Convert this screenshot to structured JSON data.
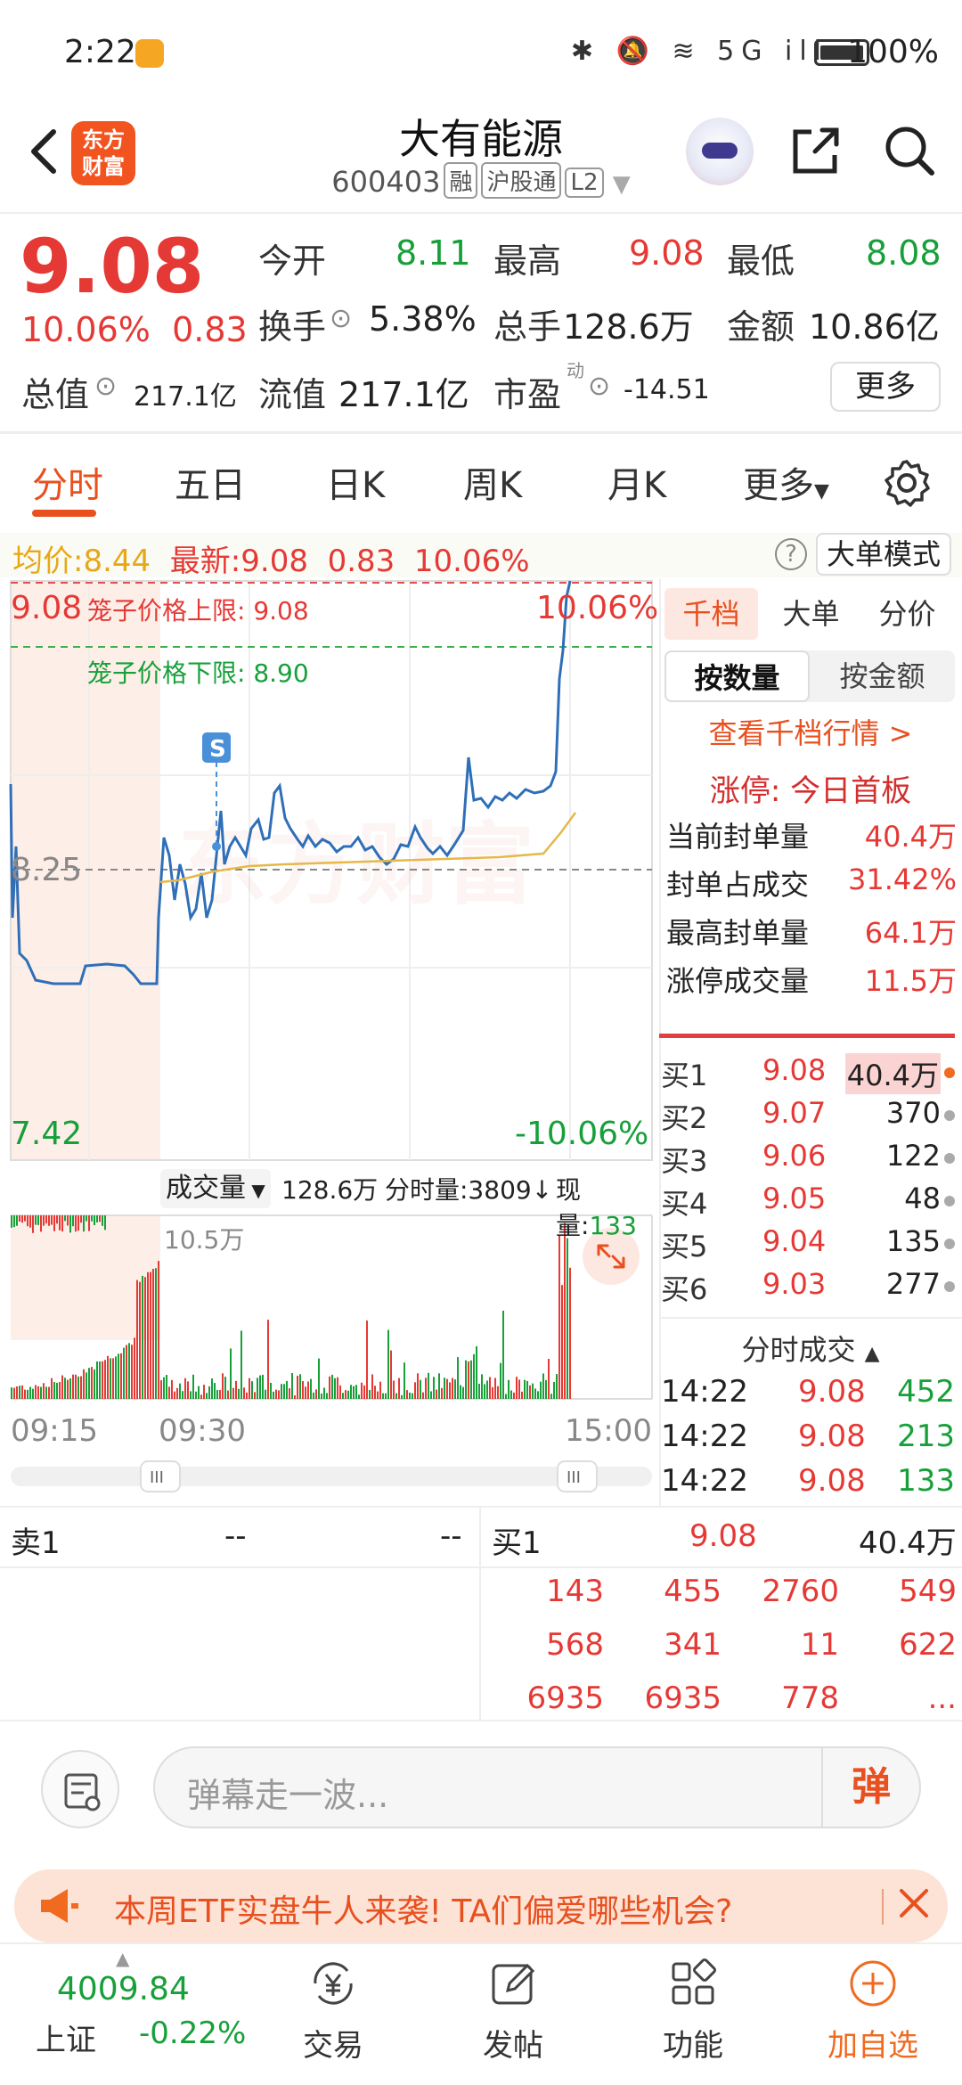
{
  "status_bar": {
    "time": "2:22",
    "battery": "100%",
    "icons": "✱ 🔕 ≋ 5G ill"
  },
  "header": {
    "logo_line1": "东方",
    "logo_line2": "财富",
    "stock_name": "大有能源",
    "stock_code": "600403",
    "tags": [
      "融",
      "沪股通",
      "L2"
    ]
  },
  "quote": {
    "price": "9.08",
    "change_pct": "10.06%",
    "change_abs": "0.83",
    "open_label": "今开",
    "open": "8.11",
    "high_label": "最高",
    "high": "9.08",
    "low_label": "最低",
    "low": "8.08",
    "turnover_label": "换手",
    "turnover": "5.38%",
    "volume_label": "总手",
    "volume": "128.6万",
    "amount_label": "金额",
    "amount": "10.86亿",
    "mktcap_label": "总值",
    "mktcap": "217.1亿",
    "float_label": "流值",
    "float": "217.1亿",
    "pe_label": "市盈",
    "pe_sup": "动",
    "pe": "-14.51",
    "more": "更多"
  },
  "tabs": [
    "分时",
    "五日",
    "日K",
    "周K",
    "月K",
    "更多"
  ],
  "avg_bar": {
    "avg_label": "均价:",
    "avg": "8.44",
    "latest_label": "最新:",
    "latest": "9.08",
    "chg": "0.83",
    "pct": "10.06%",
    "help": "?",
    "big_order": "大单模式"
  },
  "chart": {
    "top_price": "9.08",
    "upper_limit": "笼子价格上限: 9.08",
    "lower_limit": "笼子价格下限: 8.90",
    "top_pct": "10.06%",
    "mid_price": "8.25",
    "bottom_price": "7.42",
    "bottom_pct": "-10.06%",
    "marker": "S",
    "watermark": "东方财富",
    "vol_selector": "成交量",
    "vol_total": "128.6万",
    "vol_minute": "分时量:3809↓",
    "vol_now_label": "现量:",
    "vol_now": "133",
    "vol_max": "10.5万",
    "time_start": "09:15",
    "time_open": "09:30",
    "time_end": "15:00"
  },
  "chart_data": {
    "type": "line",
    "title": "",
    "xlabel": "",
    "ylabel": "",
    "ylim": [
      7.42,
      9.08
    ],
    "x": [
      "09:15",
      "09:30",
      "15:00"
    ],
    "series": [
      {
        "name": "",
        "values": [
          8.2,
          7.88,
          8.0,
          8.0,
          8.5,
          8.55,
          8.28,
          8.3,
          8.42,
          8.35,
          8.3,
          8.45,
          8.55,
          8.45,
          8.55,
          9.08
        ]
      },
      {
        "name": "均价",
        "values": [
          8.25,
          8.25,
          8.25,
          8.25,
          8.27,
          8.3,
          8.32,
          8.33,
          8.34,
          8.35,
          8.36,
          8.37,
          8.39,
          8.4,
          8.42,
          8.44
        ]
      }
    ]
  },
  "right_panel": {
    "tabs": [
      "千档",
      "大单",
      "分价"
    ],
    "seg": [
      "按数量",
      "按金额"
    ],
    "link": "查看千档行情 >",
    "limit_title": "涨停: 今日首板",
    "stats": [
      {
        "label": "当前封单量",
        "value": "40.4万"
      },
      {
        "label": "封单占成交",
        "value": "31.42%"
      },
      {
        "label": "最高封单量",
        "value": "64.1万"
      },
      {
        "label": "涨停成交量",
        "value": "11.5万"
      }
    ],
    "bids": [
      {
        "label": "买1",
        "price": "9.08",
        "vol": "40.4万"
      },
      {
        "label": "买2",
        "price": "9.07",
        "vol": "370"
      },
      {
        "label": "买3",
        "price": "9.06",
        "vol": "122"
      },
      {
        "label": "买4",
        "price": "9.05",
        "vol": "48"
      },
      {
        "label": "买5",
        "price": "9.04",
        "vol": "135"
      },
      {
        "label": "买6",
        "price": "9.03",
        "vol": "277"
      }
    ],
    "ticks_title": "分时成交",
    "ticks": [
      {
        "time": "14:22",
        "price": "9.08",
        "vol": "452"
      },
      {
        "time": "14:22",
        "price": "9.08",
        "vol": "213"
      },
      {
        "time": "14:22",
        "price": "9.08",
        "vol": "133"
      }
    ]
  },
  "book": {
    "sell_label": "卖1",
    "sell_p": "--",
    "sell_v": "--",
    "buy_label": "买1",
    "buy_p": "9.08",
    "buy_v": "40.4万",
    "queue": [
      [
        "143",
        "455",
        "2760",
        "549"
      ],
      [
        "568",
        "341",
        "11",
        "622"
      ],
      [
        "6935",
        "6935",
        "778",
        "..."
      ]
    ]
  },
  "comment": {
    "placeholder": "弹幕走一波...",
    "danmu": "弹"
  },
  "promo": {
    "text": "本周ETF实盘牛人来袭! TA们偏爱哪些机会?"
  },
  "bottom_nav": {
    "index_value": "4009.84",
    "index_name": "上证",
    "index_chg": "-0.22%",
    "items": [
      "交易",
      "发帖",
      "功能",
      "加自选"
    ]
  }
}
